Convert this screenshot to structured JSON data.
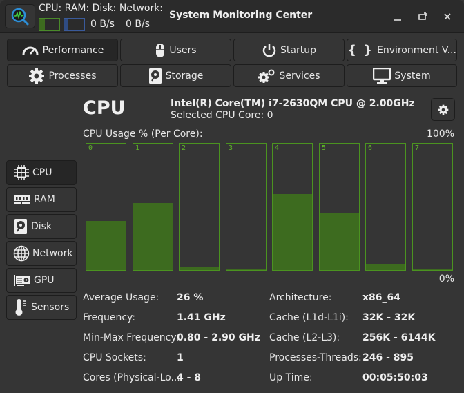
{
  "window": {
    "title": "System Monitoring Center",
    "icon": "system-monitor-app-icon",
    "controls": {
      "minimize_icon": "minimize-icon",
      "maximize_icon": "restore-icon",
      "close_icon": "close-icon"
    }
  },
  "header_monitor": {
    "labels": "CPU: RAM: Disk: Network:",
    "cpu_bar_fraction": 0.26,
    "ram_bar_fraction": 0.2,
    "disk_speed": "0 B/s",
    "network_speed": "0 B/s",
    "colors": {
      "cpu": "#3d6b1f",
      "ram": "#2f4c84"
    }
  },
  "main_tabs": [
    {
      "label": "Performance",
      "icon": "gauge-icon",
      "active": true
    },
    {
      "label": "Users",
      "icon": "mouse-icon",
      "active": false
    },
    {
      "label": "Startup",
      "icon": "power-icon",
      "active": false
    },
    {
      "label": "Environment V...",
      "icon": "braces-icon",
      "active": false
    },
    {
      "label": "Processes",
      "icon": "gear-icon",
      "active": false
    },
    {
      "label": "Storage",
      "icon": "disk-icon",
      "active": false
    },
    {
      "label": "Services",
      "icon": "gears-icon",
      "active": false
    },
    {
      "label": "System",
      "icon": "monitor-icon",
      "active": false
    }
  ],
  "sidebar": {
    "items": [
      {
        "label": "CPU",
        "icon": "cpu-icon",
        "active": true
      },
      {
        "label": "RAM",
        "icon": "ram-icon",
        "active": false
      },
      {
        "label": "Disk",
        "icon": "disk-icon",
        "active": false
      },
      {
        "label": "Network",
        "icon": "globe-icon",
        "active": false
      },
      {
        "label": "GPU",
        "icon": "gpu-icon",
        "active": false
      },
      {
        "label": "Sensors",
        "icon": "thermometer-icon",
        "active": false
      }
    ]
  },
  "cpu": {
    "title": "CPU",
    "model": "Intel(R) Core(TM) i7-2630QM CPU @ 2.00GHz",
    "selected_core": "Selected CPU Core: 0",
    "usage_label": "CPU Usage % (Per Core):",
    "scale_max": "100%",
    "scale_min": "0%",
    "accent_color": "#4b9320",
    "cores": [
      {
        "label": "0",
        "usage_percent": 39
      },
      {
        "label": "1",
        "usage_percent": 53
      },
      {
        "label": "2",
        "usage_percent": 2
      },
      {
        "label": "3",
        "usage_percent": 1
      },
      {
        "label": "4",
        "usage_percent": 60
      },
      {
        "label": "5",
        "usage_percent": 45
      },
      {
        "label": "6",
        "usage_percent": 5
      },
      {
        "label": "7",
        "usage_percent": 0
      }
    ],
    "info_left": [
      {
        "label": "Average Usage:",
        "value": "26 %"
      },
      {
        "label": "Frequency:",
        "value": "1.41 GHz"
      },
      {
        "label": "Min-Max Frequency:",
        "value": "0.80 - 2.90 GHz"
      },
      {
        "label": "CPU Sockets:",
        "value": "1"
      },
      {
        "label": "Cores (Physical-Lo...",
        "value": "4 - 8"
      }
    ],
    "info_right": [
      {
        "label": "Architecture:",
        "value": "x86_64"
      },
      {
        "label": "Cache (L1d-L1i):",
        "value": "32K - 32K"
      },
      {
        "label": "Cache (L2-L3):",
        "value": "256K - 6144K"
      },
      {
        "label": "Processes-Threads:",
        "value": "246 - 895"
      },
      {
        "label": "Up Time:",
        "value": "00:05:50:03"
      }
    ]
  }
}
